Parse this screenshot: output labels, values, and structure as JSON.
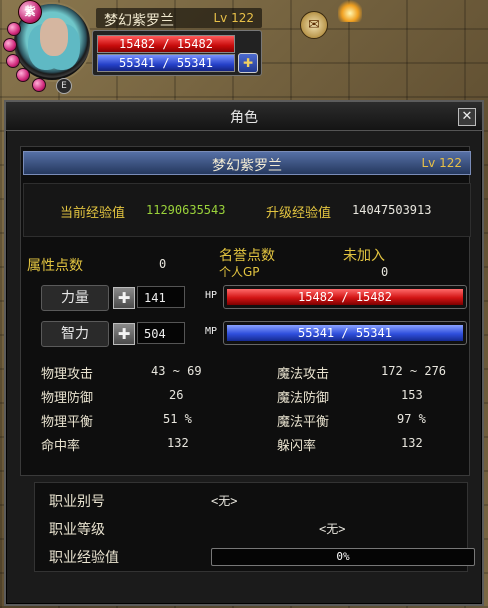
{
  "hud": {
    "name": "梦幻紫罗兰",
    "level": "Lv 122",
    "hp_text": "15482 / 15482",
    "mp_text": "55341 / 55341",
    "hp_fraction": 1.0,
    "mp_fraction": 1.0,
    "badge_text": "紫",
    "bottom_badge": "E"
  },
  "window": {
    "title": "角色",
    "close_symbol": "✕",
    "name": "梦幻紫罗兰",
    "level": "Lv 122",
    "exp": {
      "current_label": "当前经验值",
      "current_value": "11290635543",
      "next_label": "升级经验值",
      "next_value": "14047503913"
    },
    "points": {
      "attr_label": "属性点数",
      "attr_value": "0",
      "honor_label": "名誉点数",
      "honor_value": "未加入",
      "gp_label": "个人GP",
      "gp_value": "0"
    },
    "stats": [
      {
        "name": "力量",
        "value": "141",
        "bar_label": "HP",
        "bar_text": "15482 / 15482",
        "fill": 1.0
      },
      {
        "name": "智力",
        "value": "504",
        "bar_label": "MP",
        "bar_text": "55341 / 55341",
        "fill": 1.0
      }
    ],
    "combat": [
      {
        "label": "物理攻击",
        "value": "43 ~ 69",
        "label2": "魔法攻击",
        "value2": "172 ~ 276"
      },
      {
        "label": "物理防御",
        "value": "26",
        "label2": "魔法防御",
        "value2": "153"
      },
      {
        "label": "物理平衡",
        "value": "51 %",
        "label2": "魔法平衡",
        "value2": "97 %"
      },
      {
        "label": "命中率",
        "value": "132",
        "label2": "躲闪率",
        "value2": "132"
      }
    ],
    "job": {
      "title_label": "职业别号",
      "title_value": "<无>",
      "level_label": "职业等级",
      "level_value": "<无>",
      "exp_label": "职业经验值",
      "exp_text": "0%",
      "exp_fraction": 0
    }
  },
  "colors": {
    "hp": "#d21414",
    "mp": "#2f4fdc",
    "gold": "#e2c440",
    "exp_green": "#9ad23a"
  }
}
